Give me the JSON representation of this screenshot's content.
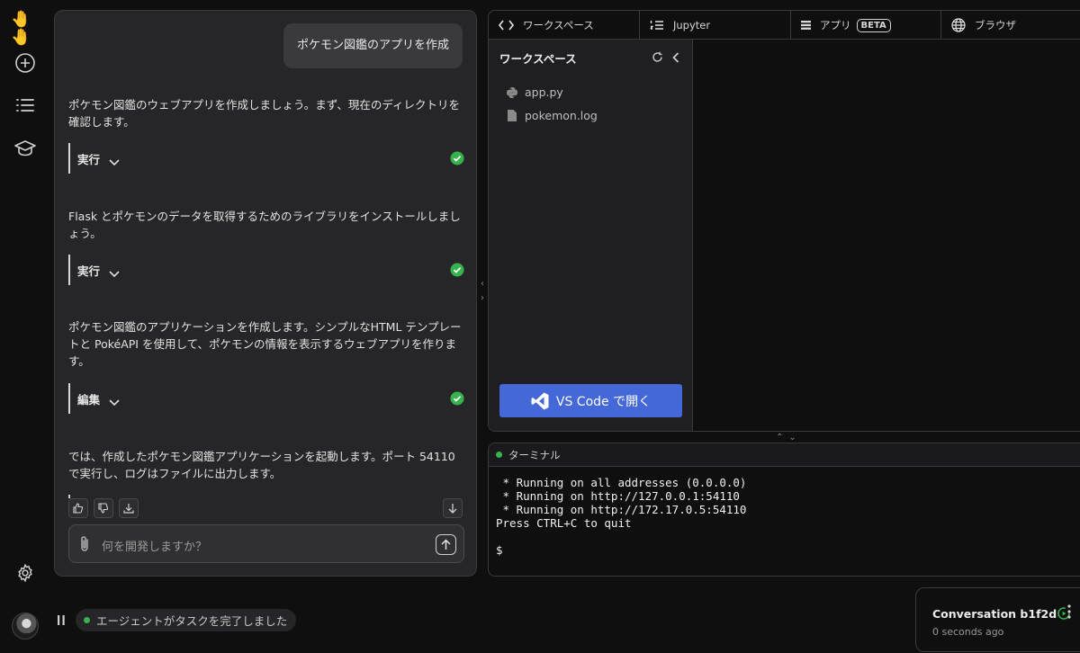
{
  "sidebar": {
    "logo": "🤚🤚",
    "icons": [
      "plus-circle-icon",
      "list-icon",
      "graduation-cap-icon",
      "gear-icon"
    ]
  },
  "chat": {
    "user_message": "ポケモン図鑑のアプリを作成",
    "messages": [
      {
        "text": "ポケモン図鑑のウェブアプリを作成しましょう。まず、現在のディレクトリを確認します。",
        "action": "実行"
      },
      {
        "text": "Flask とポケモンのデータを取得するためのライブラリをインストールしましょう。",
        "action": "実行"
      },
      {
        "text": "ポケモン図鑑のアプリケーションを作成します。シンプルなHTML テンプレートと PokéAPI を使用して、ポケモンの情報を表示するウェブアプリを作ります。",
        "action": "編集"
      },
      {
        "text": "では、作成したポケモン図鑑アプリケーションを起動します。ポート 54110 で実行し、ログはファイルに出力します。"
      }
    ],
    "composer_placeholder": "何を開発しますか？"
  },
  "status": {
    "text": "エージェントがタスクを完了しました"
  },
  "workspace": {
    "tabs": [
      {
        "label": "ワークスペース",
        "icon": "code-icon"
      },
      {
        "label": "Jupyter",
        "icon": "numbered-list-icon"
      },
      {
        "label": "アプリ",
        "icon": "server-icon",
        "badge": "BETA"
      },
      {
        "label": "ブラウザ",
        "icon": "globe-icon"
      }
    ],
    "explorer_title": "ワークスペース",
    "files": [
      {
        "name": "app.py",
        "icon": "python-icon"
      },
      {
        "name": "pokemon.log",
        "icon": "file-icon"
      }
    ],
    "open_button": "VS Code で開く"
  },
  "terminal": {
    "title": "ターミナル",
    "output": " * Running on all addresses (0.0.0.0)\n * Running on http://127.0.0.1:54110\n * Running on http://172.17.0.5:54110\nPress CTRL+C to quit\n\n$"
  },
  "conversation": {
    "title": "Conversation b1f2d",
    "subtitle": "0 seconds ago"
  },
  "colors": {
    "accent": "#4468d8",
    "success": "#37b24d",
    "panel": "#262628",
    "background": "#0f0f10"
  }
}
